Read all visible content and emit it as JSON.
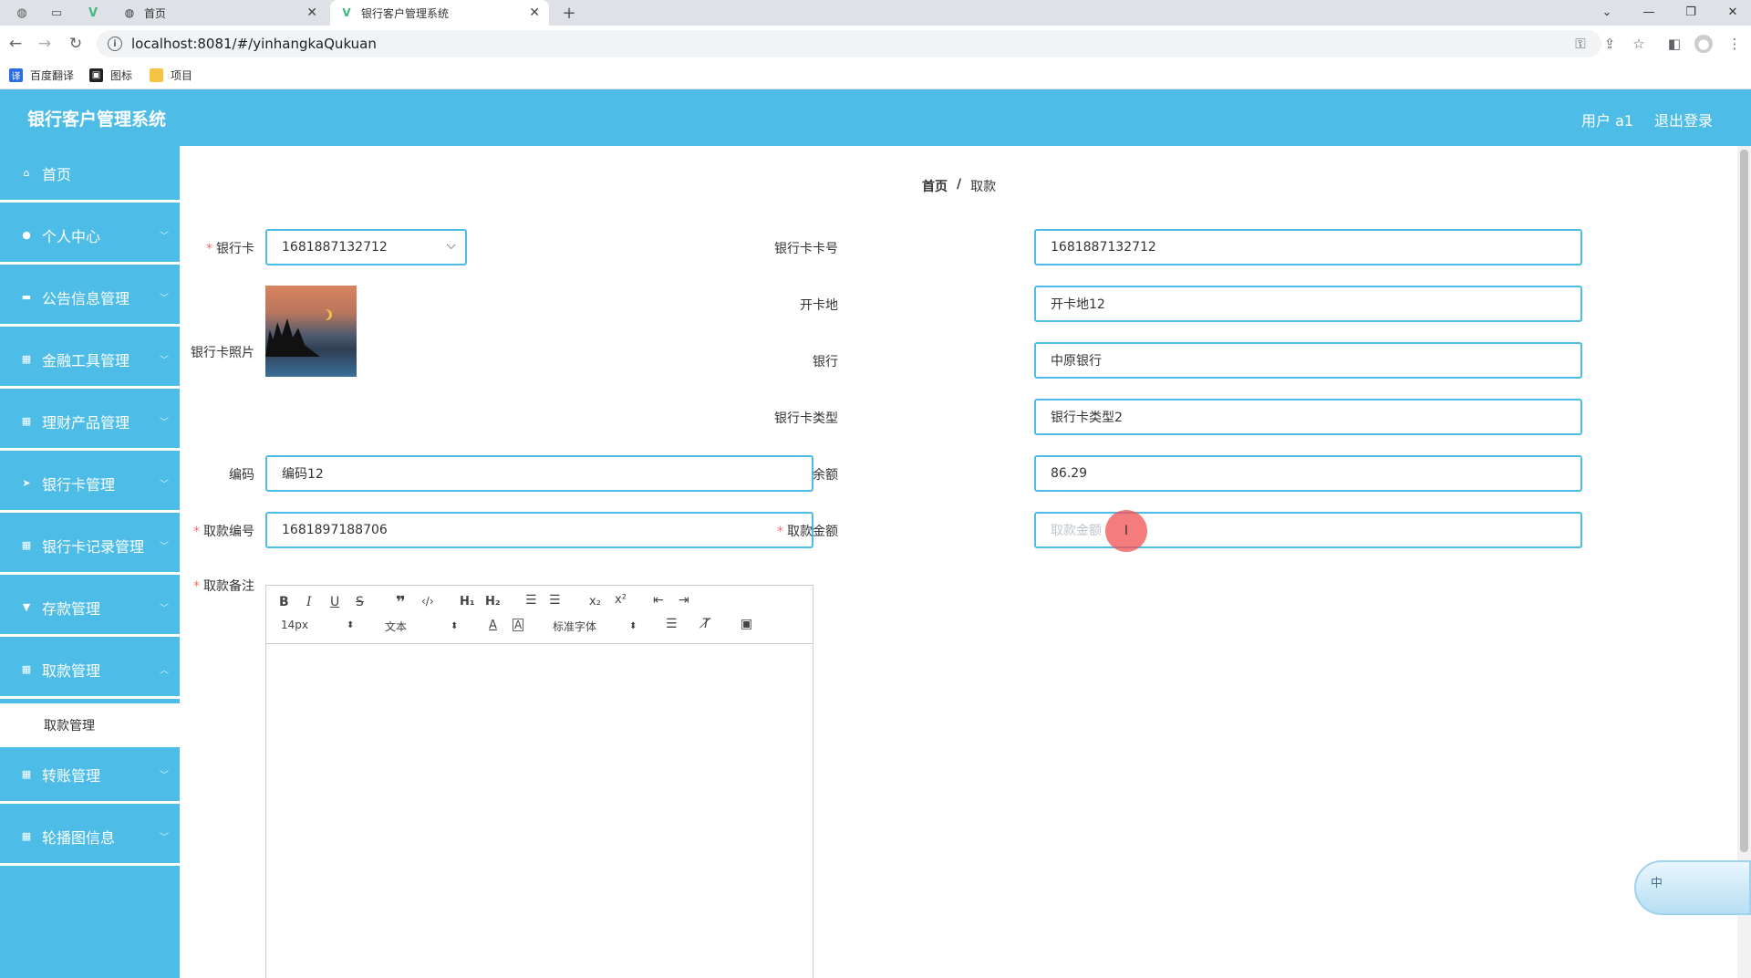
{
  "browser": {
    "tabs": [
      {
        "title": "首页",
        "active": false
      },
      {
        "title": "银行客户管理系统",
        "active": true
      }
    ],
    "url": "localhost:8081/#/yinhangkaQukuan",
    "bookmarks": [
      "百度翻译",
      "图标",
      "项目"
    ]
  },
  "app": {
    "title": "银行客户管理系统",
    "user": "用户 a1",
    "logout": "退出登录"
  },
  "sidebar": {
    "items": [
      {
        "label": "首页",
        "icon": "home-icon"
      },
      {
        "label": "个人中心",
        "icon": "user-icon"
      },
      {
        "label": "公告信息管理",
        "icon": "ticket-icon"
      },
      {
        "label": "金融工具管理",
        "icon": "grid-icon"
      },
      {
        "label": "理财产品管理",
        "icon": "grid-icon"
      },
      {
        "label": "银行卡管理",
        "icon": "send-icon"
      },
      {
        "label": "银行卡记录管理",
        "icon": "grid-icon"
      },
      {
        "label": "存款管理",
        "icon": "cup-icon"
      },
      {
        "label": "取款管理",
        "icon": "grid-icon"
      },
      {
        "label": "转账管理",
        "icon": "grid-icon"
      },
      {
        "label": "轮播图信息",
        "icon": "grid-icon"
      }
    ],
    "sub_item": "取款管理"
  },
  "breadcrumb": {
    "home": "首页",
    "sep": "/",
    "current": "取款"
  },
  "form": {
    "card_label": "银行卡",
    "card_value": "1681887132712",
    "card_photo_label": "银行卡照片",
    "card_no_label": "银行卡卡号",
    "card_no_value": "1681887132712",
    "open_place_label": "开卡地",
    "open_place_value": "开卡地12",
    "bank_label": "银行",
    "bank_value": "中原银行",
    "card_type_label": "银行卡类型",
    "card_type_value": "银行卡类型2",
    "code_label": "编码",
    "code_value": "编码12",
    "balance_label": "余额",
    "balance_value": "86.29",
    "withdraw_no_label": "取款编号",
    "withdraw_no_value": "1681897188706",
    "withdraw_amount_label": "取款金额",
    "withdraw_amount_placeholder": "取款金额",
    "note_label": "取款备注"
  },
  "editor": {
    "font_size": "14px",
    "block_type": "文本",
    "font_family": "标准字体"
  },
  "widget": {
    "text": "中"
  }
}
